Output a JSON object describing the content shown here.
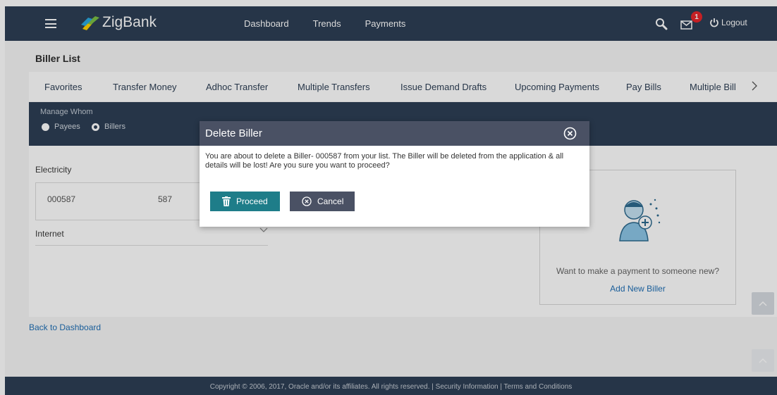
{
  "header": {
    "brand": "ZigBank",
    "nav": [
      "Dashboard",
      "Trends",
      "Payments"
    ],
    "notification_count": "1",
    "logout_label": "Logout"
  },
  "page": {
    "title": "Biller List",
    "tabs": [
      "Favorites",
      "Transfer Money",
      "Adhoc Transfer",
      "Multiple Transfers",
      "Issue Demand Drafts",
      "Upcoming Payments",
      "Pay Bills",
      "Multiple Bill"
    ],
    "manage_label": "Manage Whom",
    "radio_payees": "Payees",
    "radio_billers": "Billers",
    "selected_radio": "Billers",
    "categories": [
      {
        "name": "Electricity",
        "billers": [
          {
            "id": "000587",
            "nickname": "587"
          }
        ]
      },
      {
        "name": "Internet",
        "billers": []
      }
    ],
    "add_card": {
      "text": "Want to make a payment to someone new?",
      "link": "Add New Biller"
    },
    "back_link": "Back to Dashboard"
  },
  "modal": {
    "title": "Delete Biller",
    "message": "You are about to delete a Biller- 000587 from your list. The Biller will be deleted from the application & all details will be lost! Are you sure you want to proceed?",
    "proceed_label": "Proceed",
    "cancel_label": "Cancel"
  },
  "footer": {
    "text": "Copyright © 2006, 2017, Oracle and/or its affiliates. All rights reserved. | Security Information | Terms and Conditions"
  },
  "colors": {
    "header_bg": "#2d3f55",
    "modal_header_bg": "#4a5164",
    "proceed_bg": "#1e7d89",
    "link": "#1f6fb5",
    "badge": "#e8262b"
  },
  "icons": {
    "menu": "hamburger-icon",
    "search": "search-icon",
    "mail": "mail-icon",
    "logout": "power-icon",
    "close": "close-circle-icon",
    "proceed": "trash-icon",
    "cancel": "cancel-circle-icon"
  }
}
